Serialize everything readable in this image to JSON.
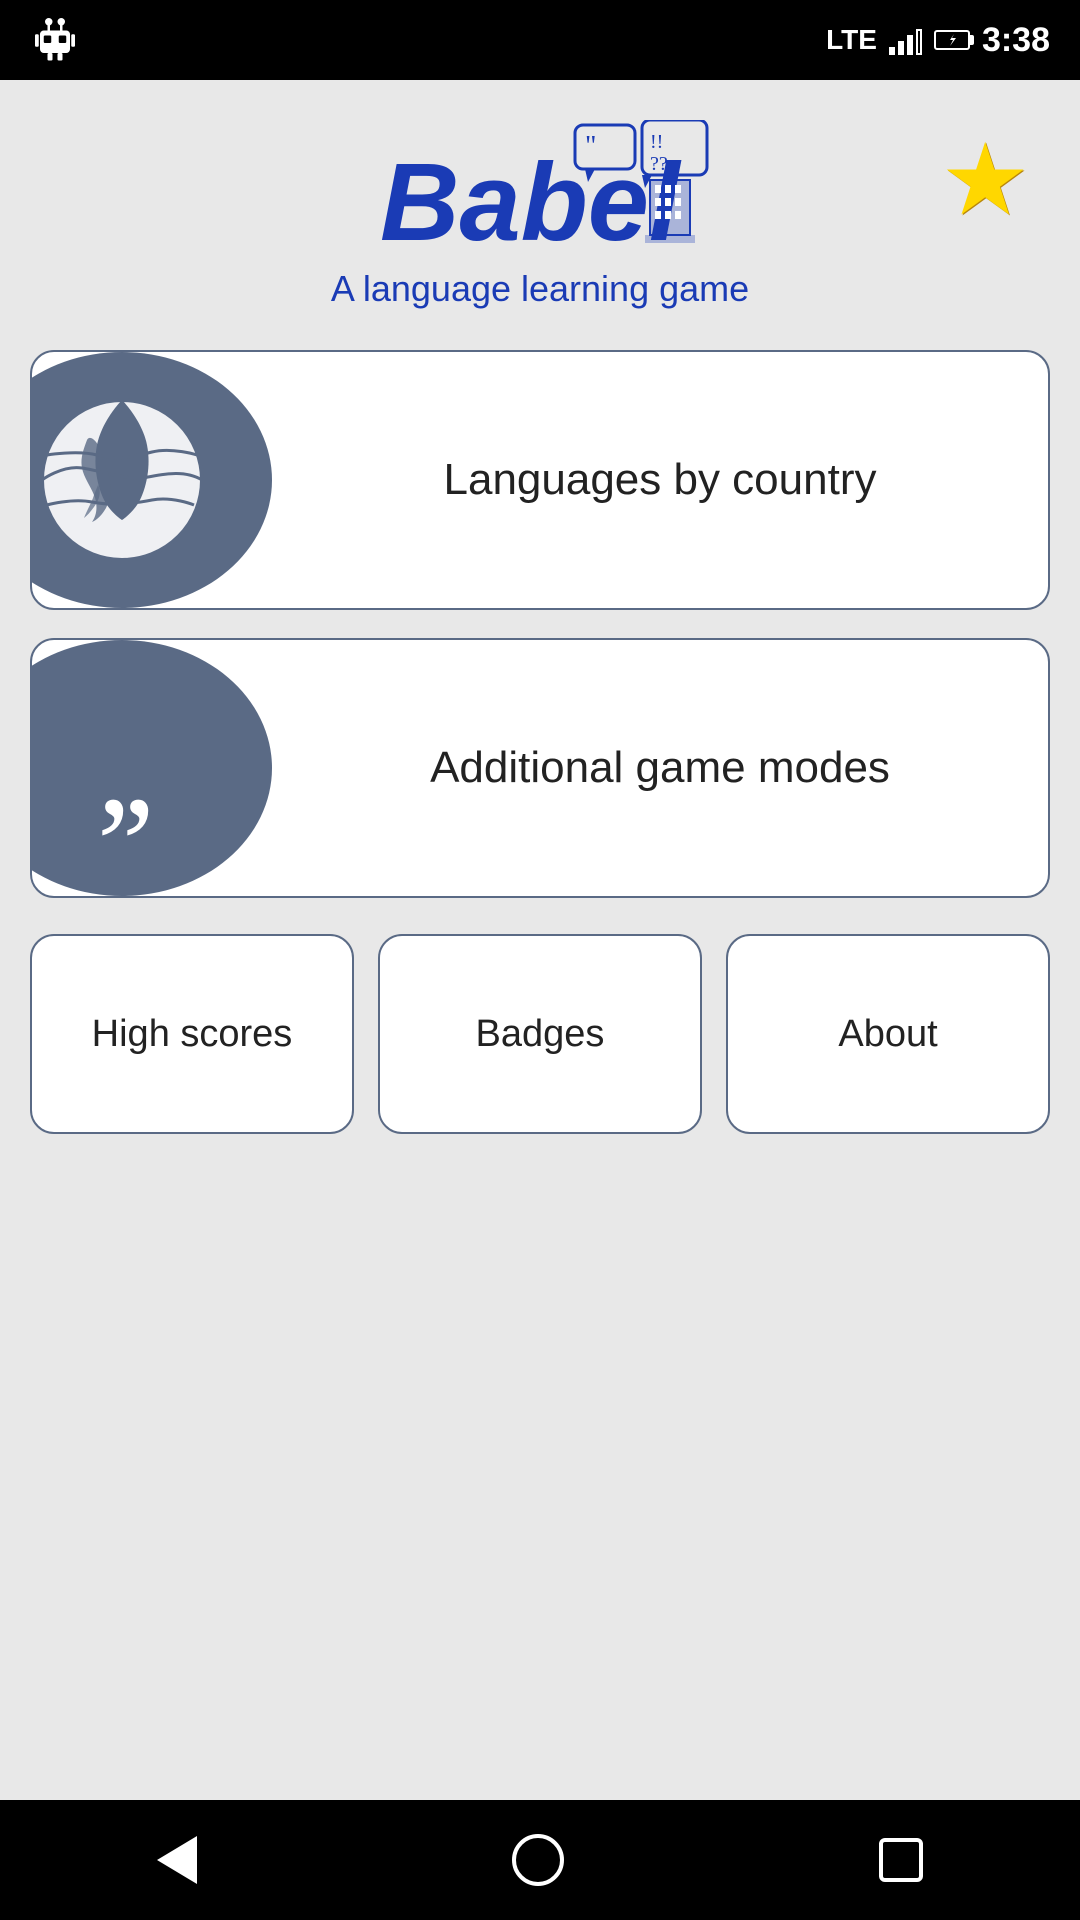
{
  "status_bar": {
    "lte_label": "LTE",
    "time": "3:38"
  },
  "header": {
    "logo_alt": "Babel logo",
    "subtitle": "A language learning game",
    "star_label": "Favorites"
  },
  "menu": {
    "languages_label": "Languages by\ncountry",
    "game_modes_label": "Additional game modes"
  },
  "bottom_buttons": {
    "high_scores": "High scores",
    "badges": "Badges",
    "about": "About"
  },
  "nav": {
    "back": "back",
    "home": "home",
    "recents": "recents"
  }
}
